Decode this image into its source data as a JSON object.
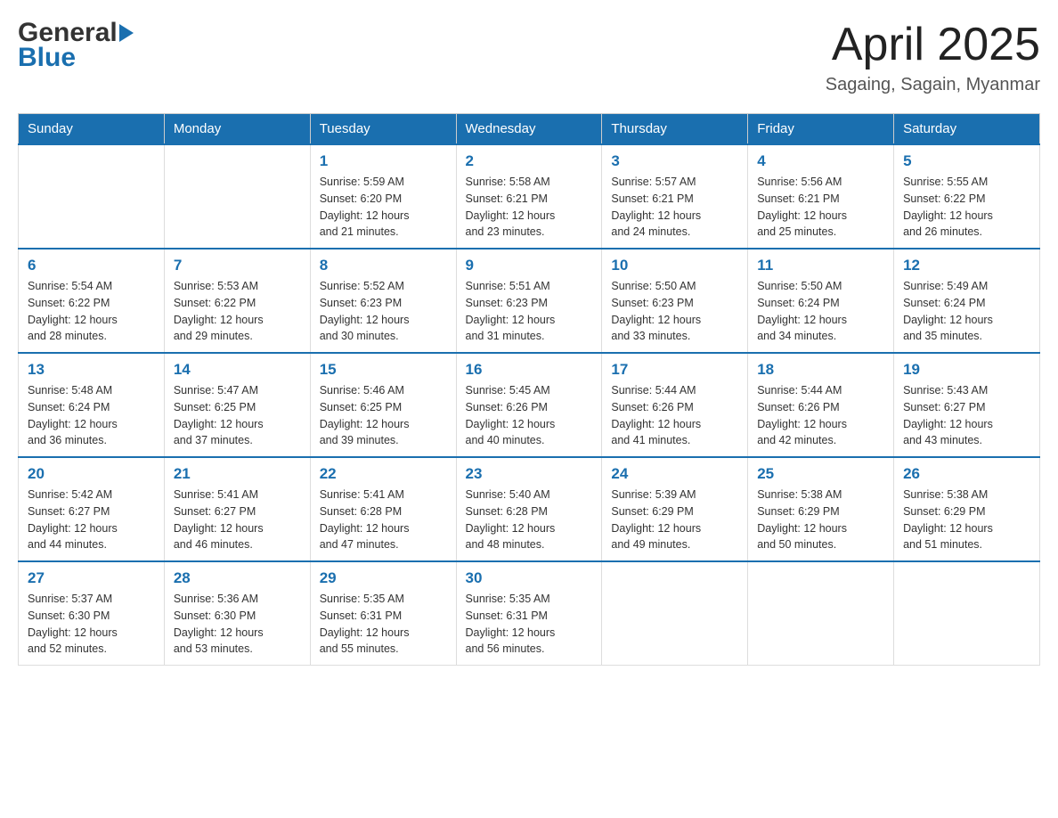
{
  "header": {
    "logo_line1": "General",
    "logo_line2": "Blue",
    "title": "April 2025",
    "subtitle": "Sagaing, Sagain, Myanmar"
  },
  "calendar": {
    "days_of_week": [
      "Sunday",
      "Monday",
      "Tuesday",
      "Wednesday",
      "Thursday",
      "Friday",
      "Saturday"
    ],
    "weeks": [
      [
        {
          "day": "",
          "info": ""
        },
        {
          "day": "",
          "info": ""
        },
        {
          "day": "1",
          "info": "Sunrise: 5:59 AM\nSunset: 6:20 PM\nDaylight: 12 hours\nand 21 minutes."
        },
        {
          "day": "2",
          "info": "Sunrise: 5:58 AM\nSunset: 6:21 PM\nDaylight: 12 hours\nand 23 minutes."
        },
        {
          "day": "3",
          "info": "Sunrise: 5:57 AM\nSunset: 6:21 PM\nDaylight: 12 hours\nand 24 minutes."
        },
        {
          "day": "4",
          "info": "Sunrise: 5:56 AM\nSunset: 6:21 PM\nDaylight: 12 hours\nand 25 minutes."
        },
        {
          "day": "5",
          "info": "Sunrise: 5:55 AM\nSunset: 6:22 PM\nDaylight: 12 hours\nand 26 minutes."
        }
      ],
      [
        {
          "day": "6",
          "info": "Sunrise: 5:54 AM\nSunset: 6:22 PM\nDaylight: 12 hours\nand 28 minutes."
        },
        {
          "day": "7",
          "info": "Sunrise: 5:53 AM\nSunset: 6:22 PM\nDaylight: 12 hours\nand 29 minutes."
        },
        {
          "day": "8",
          "info": "Sunrise: 5:52 AM\nSunset: 6:23 PM\nDaylight: 12 hours\nand 30 minutes."
        },
        {
          "day": "9",
          "info": "Sunrise: 5:51 AM\nSunset: 6:23 PM\nDaylight: 12 hours\nand 31 minutes."
        },
        {
          "day": "10",
          "info": "Sunrise: 5:50 AM\nSunset: 6:23 PM\nDaylight: 12 hours\nand 33 minutes."
        },
        {
          "day": "11",
          "info": "Sunrise: 5:50 AM\nSunset: 6:24 PM\nDaylight: 12 hours\nand 34 minutes."
        },
        {
          "day": "12",
          "info": "Sunrise: 5:49 AM\nSunset: 6:24 PM\nDaylight: 12 hours\nand 35 minutes."
        }
      ],
      [
        {
          "day": "13",
          "info": "Sunrise: 5:48 AM\nSunset: 6:24 PM\nDaylight: 12 hours\nand 36 minutes."
        },
        {
          "day": "14",
          "info": "Sunrise: 5:47 AM\nSunset: 6:25 PM\nDaylight: 12 hours\nand 37 minutes."
        },
        {
          "day": "15",
          "info": "Sunrise: 5:46 AM\nSunset: 6:25 PM\nDaylight: 12 hours\nand 39 minutes."
        },
        {
          "day": "16",
          "info": "Sunrise: 5:45 AM\nSunset: 6:26 PM\nDaylight: 12 hours\nand 40 minutes."
        },
        {
          "day": "17",
          "info": "Sunrise: 5:44 AM\nSunset: 6:26 PM\nDaylight: 12 hours\nand 41 minutes."
        },
        {
          "day": "18",
          "info": "Sunrise: 5:44 AM\nSunset: 6:26 PM\nDaylight: 12 hours\nand 42 minutes."
        },
        {
          "day": "19",
          "info": "Sunrise: 5:43 AM\nSunset: 6:27 PM\nDaylight: 12 hours\nand 43 minutes."
        }
      ],
      [
        {
          "day": "20",
          "info": "Sunrise: 5:42 AM\nSunset: 6:27 PM\nDaylight: 12 hours\nand 44 minutes."
        },
        {
          "day": "21",
          "info": "Sunrise: 5:41 AM\nSunset: 6:27 PM\nDaylight: 12 hours\nand 46 minutes."
        },
        {
          "day": "22",
          "info": "Sunrise: 5:41 AM\nSunset: 6:28 PM\nDaylight: 12 hours\nand 47 minutes."
        },
        {
          "day": "23",
          "info": "Sunrise: 5:40 AM\nSunset: 6:28 PM\nDaylight: 12 hours\nand 48 minutes."
        },
        {
          "day": "24",
          "info": "Sunrise: 5:39 AM\nSunset: 6:29 PM\nDaylight: 12 hours\nand 49 minutes."
        },
        {
          "day": "25",
          "info": "Sunrise: 5:38 AM\nSunset: 6:29 PM\nDaylight: 12 hours\nand 50 minutes."
        },
        {
          "day": "26",
          "info": "Sunrise: 5:38 AM\nSunset: 6:29 PM\nDaylight: 12 hours\nand 51 minutes."
        }
      ],
      [
        {
          "day": "27",
          "info": "Sunrise: 5:37 AM\nSunset: 6:30 PM\nDaylight: 12 hours\nand 52 minutes."
        },
        {
          "day": "28",
          "info": "Sunrise: 5:36 AM\nSunset: 6:30 PM\nDaylight: 12 hours\nand 53 minutes."
        },
        {
          "day": "29",
          "info": "Sunrise: 5:35 AM\nSunset: 6:31 PM\nDaylight: 12 hours\nand 55 minutes."
        },
        {
          "day": "30",
          "info": "Sunrise: 5:35 AM\nSunset: 6:31 PM\nDaylight: 12 hours\nand 56 minutes."
        },
        {
          "day": "",
          "info": ""
        },
        {
          "day": "",
          "info": ""
        },
        {
          "day": "",
          "info": ""
        }
      ]
    ]
  },
  "colors": {
    "header_bg": "#1a6faf",
    "header_text": "#ffffff",
    "day_number": "#1a6faf",
    "border": "#cccccc",
    "week_border": "#1a6faf"
  }
}
